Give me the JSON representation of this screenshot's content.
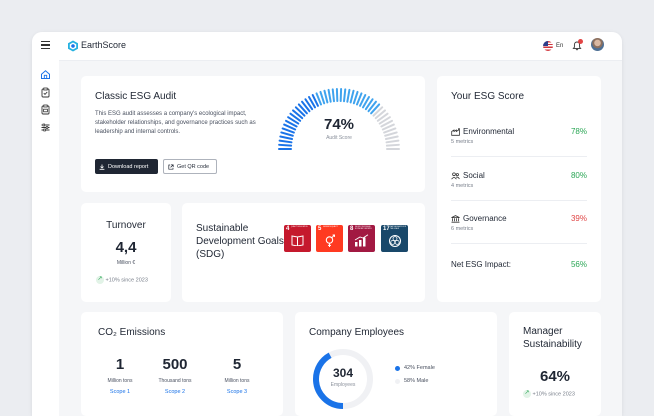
{
  "app": {
    "name": "EarthScore"
  },
  "topbar": {
    "language": "En"
  },
  "audit": {
    "title": "Classic ESG Audit",
    "description": "This ESG audit assesses a company's ecological impact, stakeholder relationships, and governance practices such as leadership and internal controls.",
    "score": "74%",
    "score_value": 0.74,
    "score_label": "Audit Score",
    "download_label": "Download report",
    "qr_label": "Get QR code"
  },
  "esg_score": {
    "title": "Your ESG Score",
    "rows": [
      {
        "label": "Environmental",
        "sub": "5 metrics",
        "value": "78%",
        "icon": "factory-icon"
      },
      {
        "label": "Social",
        "sub": "4 metrics",
        "value": "80%",
        "icon": "people-icon"
      },
      {
        "label": "Governance",
        "sub": "6 metrics",
        "value": "39%",
        "icon": "bank-icon"
      }
    ],
    "net_label": "Net ESG Impact:",
    "net_value": "56%"
  },
  "turnover": {
    "title": "Turnover",
    "value": "4,4",
    "unit": "Million €",
    "trend": "+10% since 2023"
  },
  "sdg": {
    "title": "Sustainable Development Goals (SDG)",
    "goals": [
      {
        "number": "4",
        "name": "QUALITY EDUCATION",
        "color": "#c5192d"
      },
      {
        "number": "5",
        "name": "GENDER EQUALITY",
        "color": "#ff3a21"
      },
      {
        "number": "8",
        "name": "DECENT WORK AND ECONOMIC GROWTH",
        "color": "#a21942"
      },
      {
        "number": "17",
        "name": "PARTNERSHIPS FOR THE GOALS",
        "color": "#19486a"
      }
    ]
  },
  "emissions": {
    "title": "CO₂ Emissions",
    "items": [
      {
        "value": "1",
        "unit": "Million tons",
        "scope": "Scope 1"
      },
      {
        "value": "500",
        "unit": "Thousand tons",
        "scope": "Scope 2"
      },
      {
        "value": "5",
        "unit": "Million tons",
        "scope": "Scope 3"
      }
    ]
  },
  "employees": {
    "title": "Company Employees",
    "count": "304",
    "count_label": "Employees",
    "female_share": 0.42,
    "legend": [
      {
        "label": "42% Female",
        "color": "#1a73e8"
      },
      {
        "label": "58% Male",
        "color": "#f0f1f4"
      }
    ]
  },
  "manager": {
    "title": "Manager Sustainability",
    "value": "64%",
    "trend": "+10% since 2023"
  },
  "colors": {
    "accent": "#1a73e8",
    "positive": "#2aa655",
    "negative": "#e04646",
    "dark_button": "#1f2633"
  }
}
